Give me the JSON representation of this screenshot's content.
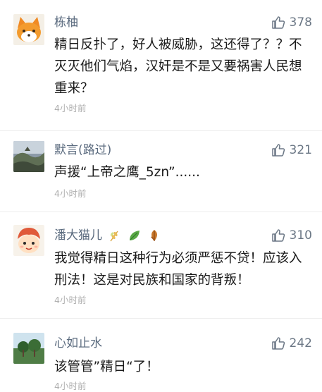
{
  "comments": [
    {
      "username": "栋柚",
      "likes": "378",
      "text": "精日反扑了，好人被威胁，这还得了？？不灭灭他们气焰，汉奸是不是又要祸害人民想重来？",
      "time": "4小时前"
    },
    {
      "username": "默言(路过)",
      "likes": "321",
      "text": "声援“上帝之鹰_5zn”......",
      "time": "4小时前"
    },
    {
      "username": "潘大猫儿",
      "likes": "310",
      "text": "我觉得精日这种行为必须严惩不贷！应该入刑法！这是对民族和国家的背叛！",
      "time": "4小时前"
    },
    {
      "username": "心如止水",
      "likes": "242",
      "text": "该管管”精日“了！",
      "time": "4小时前"
    }
  ],
  "colors": {
    "username": "#5a6a7e",
    "text": "#1a1a1a",
    "time": "#b0b0b0",
    "like": "#6b7785"
  }
}
